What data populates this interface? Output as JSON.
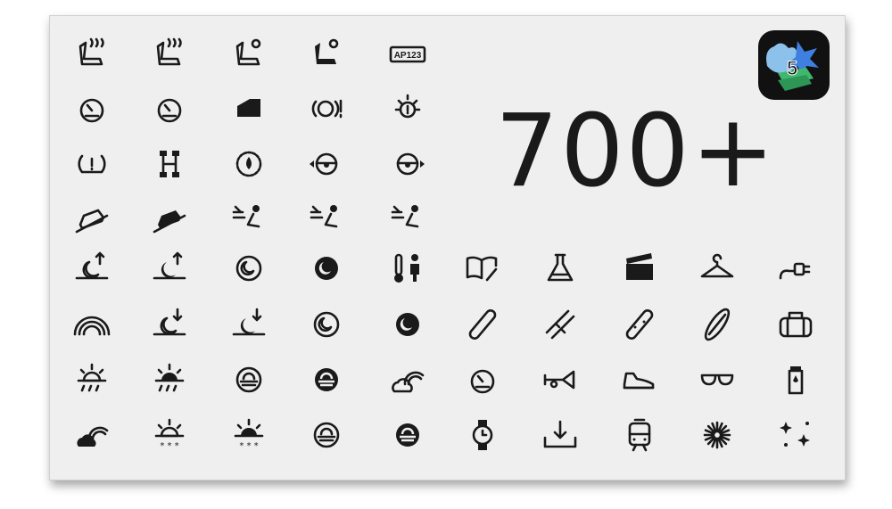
{
  "headline": "700+",
  "badge": {
    "number": "5",
    "icon": "sf-symbols-app-icon"
  },
  "icons": [
    [
      "heated-seat",
      "heated-seat-alt",
      "cooled-seat",
      "cooled-seat-fill",
      "ap123-label"
    ],
    [
      "speedometer-left",
      "speedometer-right",
      "car-door",
      "brake-warning",
      "tire-light"
    ],
    [
      "tire-pressure-warning",
      "axle-diff",
      "oil-drop-gear",
      "steering-left",
      "steering-right"
    ],
    [
      "car-descent",
      "car-ascent-fill",
      "airflow-face",
      "airflow-up",
      "airflow-down"
    ],
    [
      "moonrise",
      "moonrise-fill",
      "moon-circle",
      "moon-circle-fill",
      "thermometer-person",
      "book-wrench",
      "flask",
      "clapperboard",
      "hanger",
      "powerplug"
    ],
    [
      "rainbow",
      "moonset",
      "moonset-fill",
      "moonset-circle",
      "moonset-circle-fill",
      "skateboard",
      "skis",
      "snowboard",
      "surfboard",
      "duffle-bag"
    ],
    [
      "sun-rain",
      "sunrise-rain",
      "sunset-circle",
      "sunset-circle-fill",
      "cloud-rainbow",
      "gauge",
      "trumpet",
      "shoe",
      "sunglasses",
      "water-bottle"
    ],
    [
      "cloud-rainbow-fill",
      "sun-snow",
      "sunrise-snow",
      "sun-horizon-circle",
      "sun-horizon-circle-fill",
      "watch",
      "tray-download",
      "tram",
      "burst",
      "sparkles"
    ]
  ],
  "colors": {
    "panel": "#efefef",
    "ink": "#1a1a1a"
  }
}
